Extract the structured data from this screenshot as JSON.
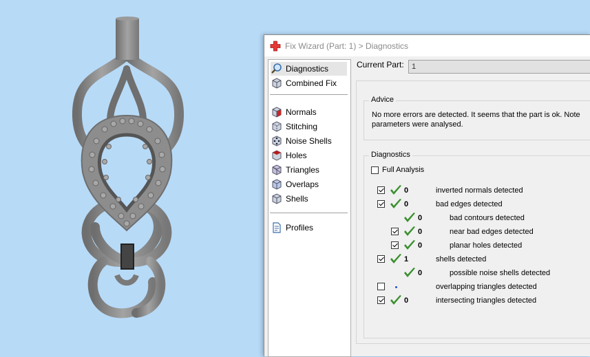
{
  "dialog": {
    "title": "Fix Wizard (Part: 1) > Diagnostics",
    "accent_color": "#e53935"
  },
  "nav": {
    "items": [
      {
        "label": "Diagnostics",
        "icon": "magnifier-icon",
        "selected": true
      },
      {
        "label": "Combined Fix",
        "icon": "combined-fix-cube-icon"
      },
      {
        "label": "Normals",
        "icon": "normals-cube-icon"
      },
      {
        "label": "Stitching",
        "icon": "stitching-cube-icon"
      },
      {
        "label": "Noise Shells",
        "icon": "noise-shells-cube-icon"
      },
      {
        "label": "Holes",
        "icon": "holes-cube-icon"
      },
      {
        "label": "Triangles",
        "icon": "triangles-cube-icon"
      },
      {
        "label": "Overlaps",
        "icon": "overlaps-cube-icon"
      },
      {
        "label": "Shells",
        "icon": "shells-cube-icon"
      },
      {
        "label": "Profiles",
        "icon": "profiles-document-icon"
      }
    ]
  },
  "current_part": {
    "label": "Current Part:",
    "value": "1"
  },
  "advice": {
    "label": "Advice",
    "line1": "No more errors are detected. It seems that the part is ok. Note",
    "line2": "parameters were analysed."
  },
  "diagnostics": {
    "label": "Diagnostics",
    "full_analysis_label": "Full Analysis",
    "full_analysis_checked": false,
    "rows": [
      {
        "checkbox": true,
        "checked": true,
        "status": "tick",
        "count": "0",
        "desc": "inverted normals detected",
        "indent": 0
      },
      {
        "checkbox": true,
        "checked": true,
        "status": "tick",
        "count": "0",
        "desc": "bad edges detected",
        "indent": 0
      },
      {
        "checkbox": false,
        "checked": false,
        "status": "tick",
        "count": "0",
        "desc": "bad contours detected",
        "indent": 1
      },
      {
        "checkbox": true,
        "checked": true,
        "status": "tick",
        "count": "0",
        "desc": "near bad edges detected",
        "indent": 1
      },
      {
        "checkbox": true,
        "checked": true,
        "status": "tick",
        "count": "0",
        "desc": "planar holes detected",
        "indent": 1
      },
      {
        "checkbox": true,
        "checked": true,
        "status": "tick",
        "count": "1",
        "desc": "shells detected",
        "indent": 0
      },
      {
        "checkbox": false,
        "checked": false,
        "status": "tick",
        "count": "0",
        "desc": "possible noise shells detected",
        "indent": 1
      },
      {
        "checkbox": true,
        "checked": false,
        "status": "dot",
        "count": "",
        "desc": "overlapping triangles detected",
        "indent": 0
      },
      {
        "checkbox": true,
        "checked": true,
        "status": "tick",
        "count": "0",
        "desc": "intersecting triangles detected",
        "indent": 0
      }
    ]
  },
  "colors": {
    "viewport_bg": "#b7daf7",
    "model_gray": "#8e8e8e",
    "tick_green": "#3a8f2e"
  }
}
